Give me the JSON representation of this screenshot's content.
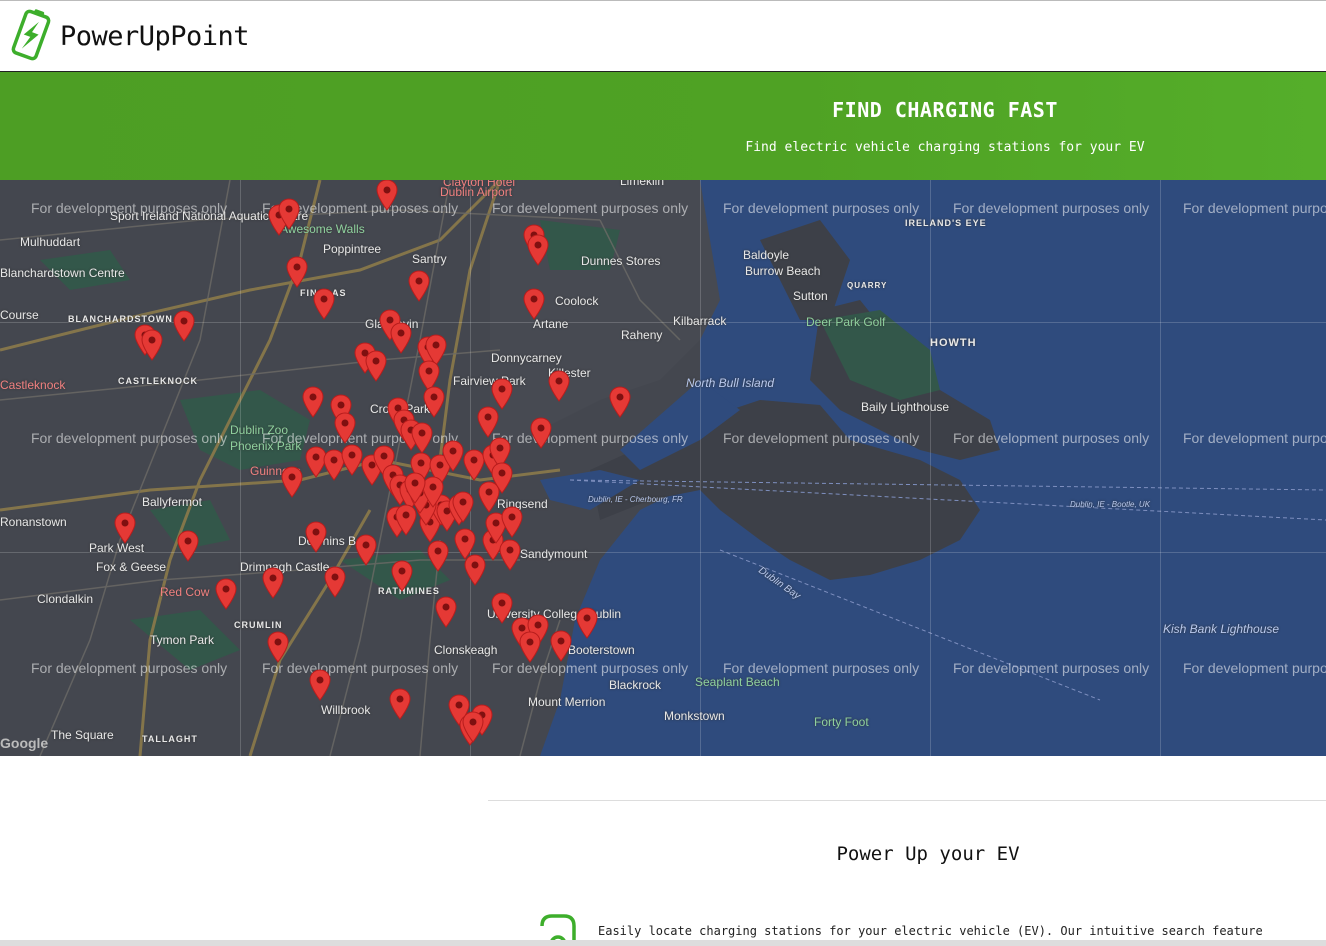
{
  "header": {
    "brand": "PowerUpPoint",
    "logo_icon": "battery-bolt-icon",
    "accent_color": "#3dae2b"
  },
  "hero": {
    "title": "FIND CHARGING FAST",
    "subtitle": "Find electric vehicle charging stations for your EV",
    "background_color": "#4fa224"
  },
  "map": {
    "watermark": "For development purposes only",
    "provider": "Google",
    "pin_color": "#e53935",
    "places": [
      "Sport Ireland National Aquatic Centre",
      "Mulhuddart",
      "Awesome Walls",
      "Poppintree",
      "Santry",
      "Dublin Airport",
      "Clayton Hotel",
      "Limekiln",
      "Dunnes Stores",
      "Baldoyle",
      "Burrow Beach",
      "Sutton",
      "Coolock",
      "Kilbarrack",
      "Artane",
      "Raheny",
      "Deer Park Golf",
      "Donnycarney",
      "Killester",
      "North Bull Island",
      "Fairview Park",
      "Baily Lighthouse",
      "HOWTH",
      "IRELAND'S EYE",
      "BLANCHARDSTOWN",
      "CASTLEKNOCK",
      "Castleknock",
      "Course",
      "Dublin Zoo",
      "Phoenix Park",
      "Ballyfermot",
      "Ronanstown",
      "Park West",
      "Fox & Geese",
      "Clondalkin",
      "Red Cow",
      "Drimnagh Castle",
      "Dolphins Barn",
      "CRUMLIN",
      "Tymon Park",
      "RATHMINES",
      "Clonskeagh",
      "University College Dublin",
      "Booterstown",
      "Blackrock",
      "Seaplant Beach",
      "Monkstown",
      "Mount Merrion",
      "Forty Foot",
      "Willbrook",
      "Kish Bank Lighthouse",
      "The Square",
      "TALLAGHT",
      "Ringsend",
      "Sandymount",
      "Croke Park",
      "Blanchardstown Centre",
      "Guinness",
      "Dublin Bay",
      "Dublin, IE - Cherbourg, FR",
      "Dublin, IE - Bootle, UK",
      "FINGLAS",
      "Glasnevin",
      "QUARRY"
    ]
  },
  "content": {
    "section_title": "Power Up your EV",
    "feature_text": "Easily locate charging stations for your electric vehicle (EV). Our intuitive search feature",
    "feature_icon": "charging-location-icon"
  }
}
